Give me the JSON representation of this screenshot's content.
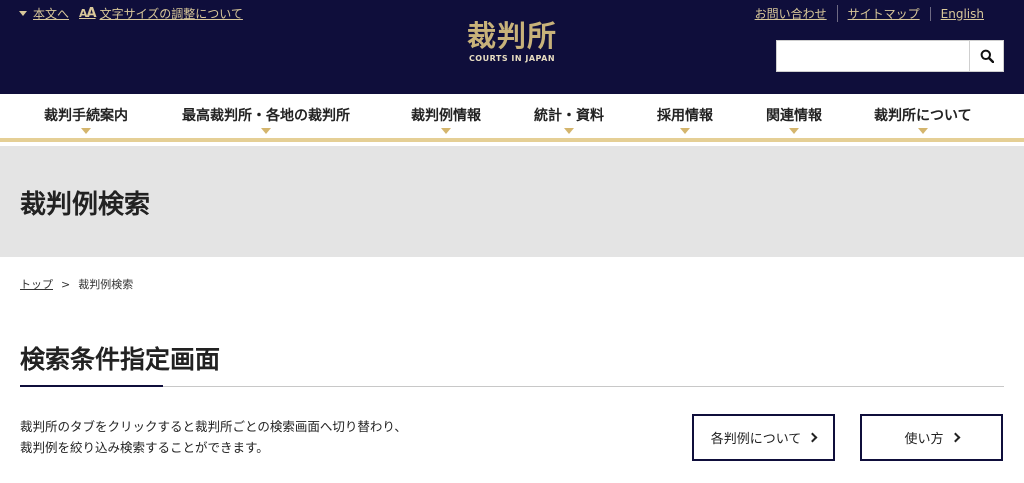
{
  "header": {
    "skip_link": "本文へ",
    "text_size_link": "文字サイズの調整について",
    "text_size_icon": "text-size-icon",
    "utility_links": [
      "お問い合わせ",
      "サイトマップ",
      "English"
    ],
    "logo_main": "裁判所",
    "logo_sub": "COURTS IN JAPAN",
    "search": {
      "value": "",
      "placeholder": "",
      "icon": "search-icon"
    }
  },
  "nav": {
    "items": [
      "裁判手続案内",
      "最高裁判所・各地の裁判所",
      "裁判例情報",
      "統計・資料",
      "採用情報",
      "関連情報",
      "裁判所について"
    ]
  },
  "page": {
    "title": "裁判例検索",
    "breadcrumb": {
      "home": "トップ",
      "separator": ">",
      "current": "裁判例検索"
    }
  },
  "section": {
    "title": "検索条件指定画面",
    "description_line1": "裁判所のタブをクリックすると裁判所ごとの検索画面へ切り替わり、",
    "description_line2": "裁判例を絞り込み検索することができます。",
    "buttons": [
      "各判例について",
      "使い方"
    ]
  },
  "colors": {
    "header_bg": "#0f0e3b",
    "gold": "#d9c89a",
    "nav_border": "#e5cf95",
    "title_band": "#e4e4e4"
  }
}
